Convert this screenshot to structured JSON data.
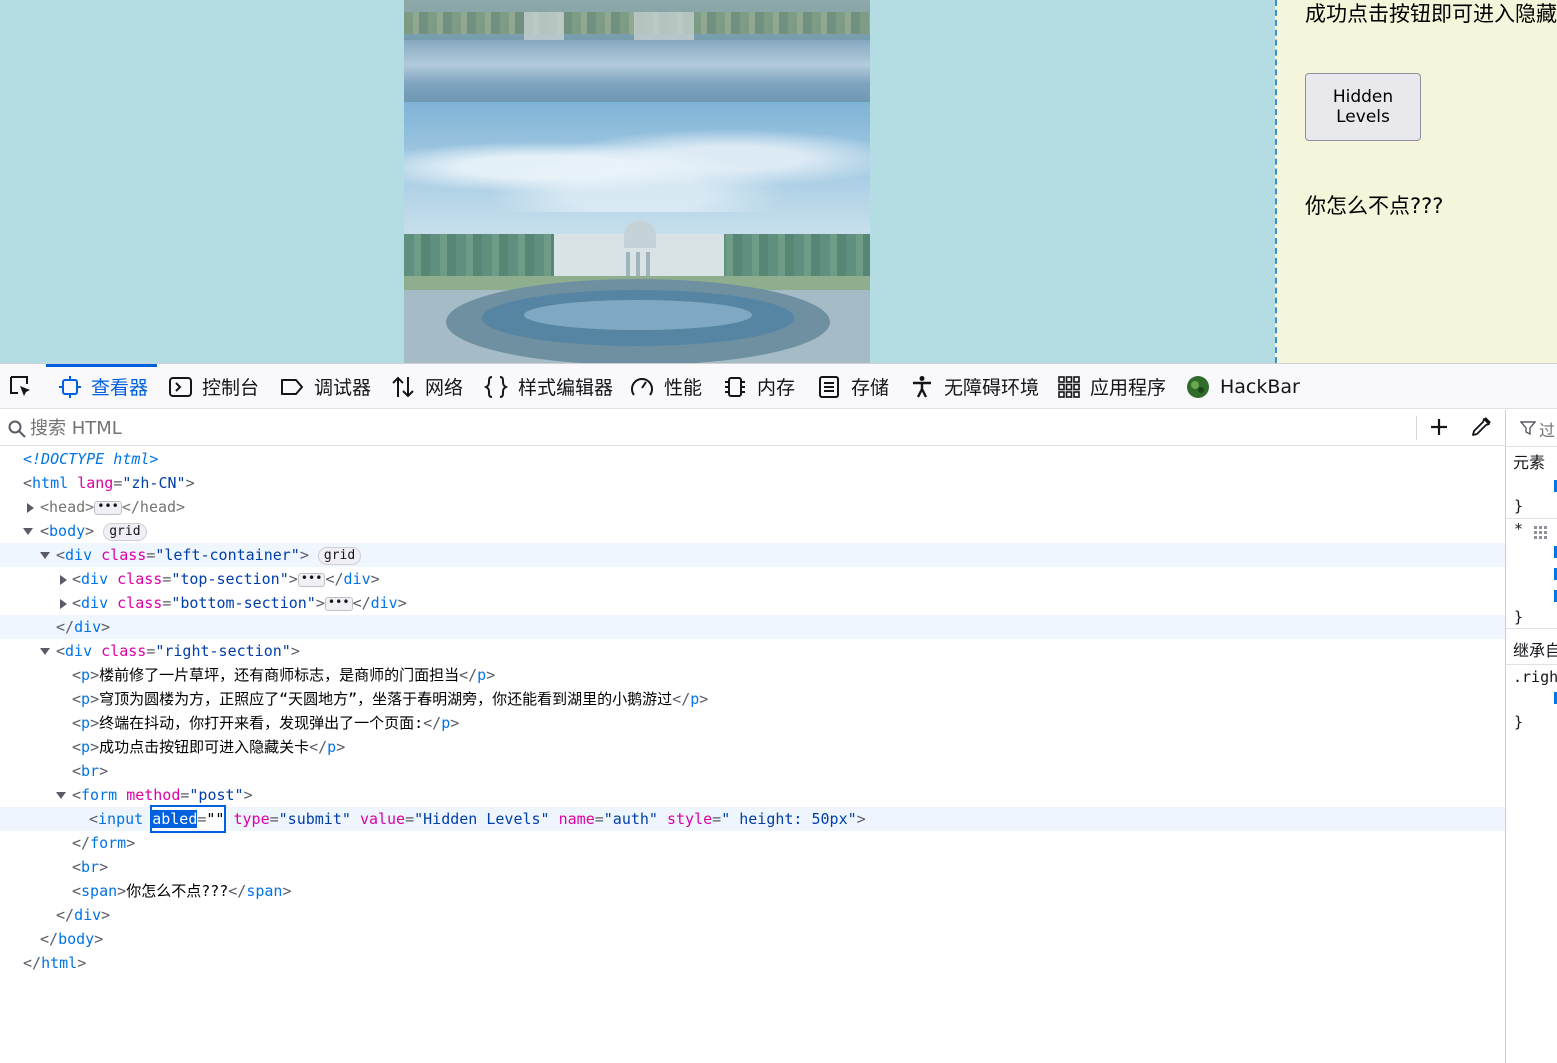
{
  "page": {
    "right_section": {
      "line_text": "成功点击按钮即可进入隐藏",
      "button_label": "Hidden Levels",
      "span_text": "你怎么不点???"
    }
  },
  "devtools": {
    "tabs": [
      {
        "label": "查看器",
        "icon": "inspector-icon",
        "active": true
      },
      {
        "label": "控制台",
        "icon": "console-icon"
      },
      {
        "label": "调试器",
        "icon": "debugger-icon"
      },
      {
        "label": "网络",
        "icon": "network-icon"
      },
      {
        "label": "样式编辑器",
        "icon": "style-editor-icon"
      },
      {
        "label": "性能",
        "icon": "performance-icon"
      },
      {
        "label": "内存",
        "icon": "memory-icon"
      },
      {
        "label": "存储",
        "icon": "storage-icon"
      },
      {
        "label": "无障碍环境",
        "icon": "accessibility-icon"
      },
      {
        "label": "应用程序",
        "icon": "application-icon"
      },
      {
        "label": "HackBar",
        "icon": "hackbar-icon"
      }
    ],
    "search_placeholder": "搜索 HTML",
    "markup": {
      "doctype": "<!DOCTYPE html>",
      "html_lang": "\"zh-CN\"",
      "grid_badge": "grid",
      "class_left": "\"left-container\"",
      "class_top": "\"top-section\"",
      "class_bottom": "\"bottom-section\"",
      "class_right": "\"right-section\"",
      "p1": "楼前修了一片草坪，还有商师标志，是商师的门面担当",
      "p2": "穹顶为圆楼为方，正照应了“天圆地方”，坐落于春明湖旁，你还能看到湖里的小鹅游过",
      "p3": "终端在抖动，你打开来看，发现弹出了一个页面:",
      "p4": "成功点击按钮即可进入隐藏关卡",
      "form_method": "\"post\"",
      "editing_attr": "abled",
      "editing_value": "\"\"",
      "input_type": "\"submit\"",
      "input_value": "\"Hidden Levels\"",
      "input_name": "\"auth\"",
      "input_style": "\" height: 50px\"",
      "span_text": "你怎么不点???"
    },
    "rules_panel": {
      "filter_label": "过",
      "element_label": "元素",
      "inherited_label": "继承自",
      "selector": ".righ"
    }
  }
}
